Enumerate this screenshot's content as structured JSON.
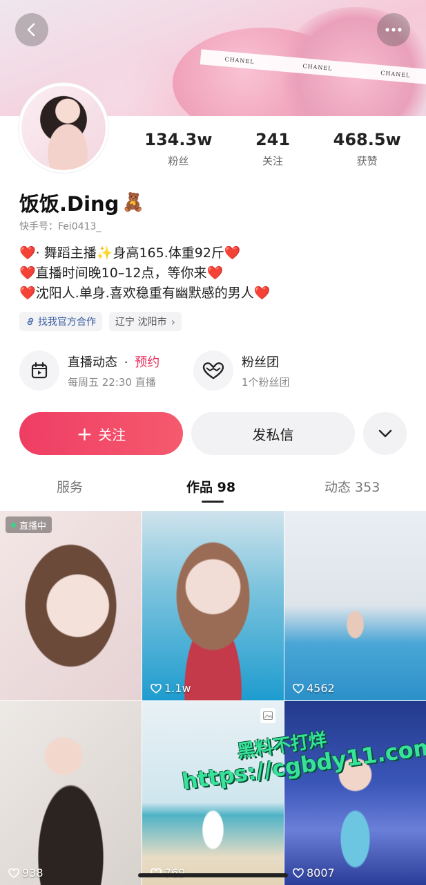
{
  "cover": {
    "ribbon_texts": [
      "CHANEL",
      "CHANEL",
      "CHANEL"
    ]
  },
  "header": {
    "back_icon": "chevron-left-icon",
    "more_icon": "ellipsis-icon"
  },
  "profile": {
    "stats": [
      {
        "value": "134.3w",
        "label": "粉丝"
      },
      {
        "value": "241",
        "label": "关注"
      },
      {
        "value": "468.5w",
        "label": "获赞"
      }
    ],
    "name": "饭饭.Ding",
    "name_emoji": "🧸",
    "kuaishou_id": "快手号：Fei0413_",
    "bio": [
      {
        "lead": "❤️",
        "text": "· 舞蹈主播",
        "sparkle": "✨",
        "text2": "身高165.体重92斤",
        "tail": "❤️"
      },
      {
        "lead": "❤️",
        "text": "直播时间晚10–12点，等你来",
        "tail": "❤️"
      },
      {
        "lead": "❤️",
        "text": "沈阳人.单身.喜欢稳重有幽默感的男人",
        "tail": "❤️"
      }
    ],
    "tags": [
      {
        "label": "找我官方合作"
      },
      {
        "label": "辽宁 沈阳市",
        "suffix": "›"
      }
    ],
    "features": [
      {
        "title": "直播动态",
        "dot": "·",
        "highlight": "预约",
        "sub": "每周五 22:30 直播"
      },
      {
        "title": "粉丝团",
        "sub": "1个粉丝团"
      }
    ],
    "actions": {
      "follow": "关注",
      "follow_plus": "+",
      "message": "发私信"
    }
  },
  "tabs": [
    {
      "label": "服务"
    },
    {
      "label": "作品 98",
      "active": true
    },
    {
      "label": "动态 353"
    }
  ],
  "grid": {
    "live_label": "直播中",
    "likes": [
      "1.1w",
      "4562",
      "938",
      "769",
      "8007"
    ]
  },
  "watermark": {
    "line1": "黑料不打烊",
    "line2": "https://cgbdy11.com"
  },
  "colors": {
    "accent": "#ef3d64",
    "link": "#3a5fa0",
    "highlight": "#e8315e"
  }
}
